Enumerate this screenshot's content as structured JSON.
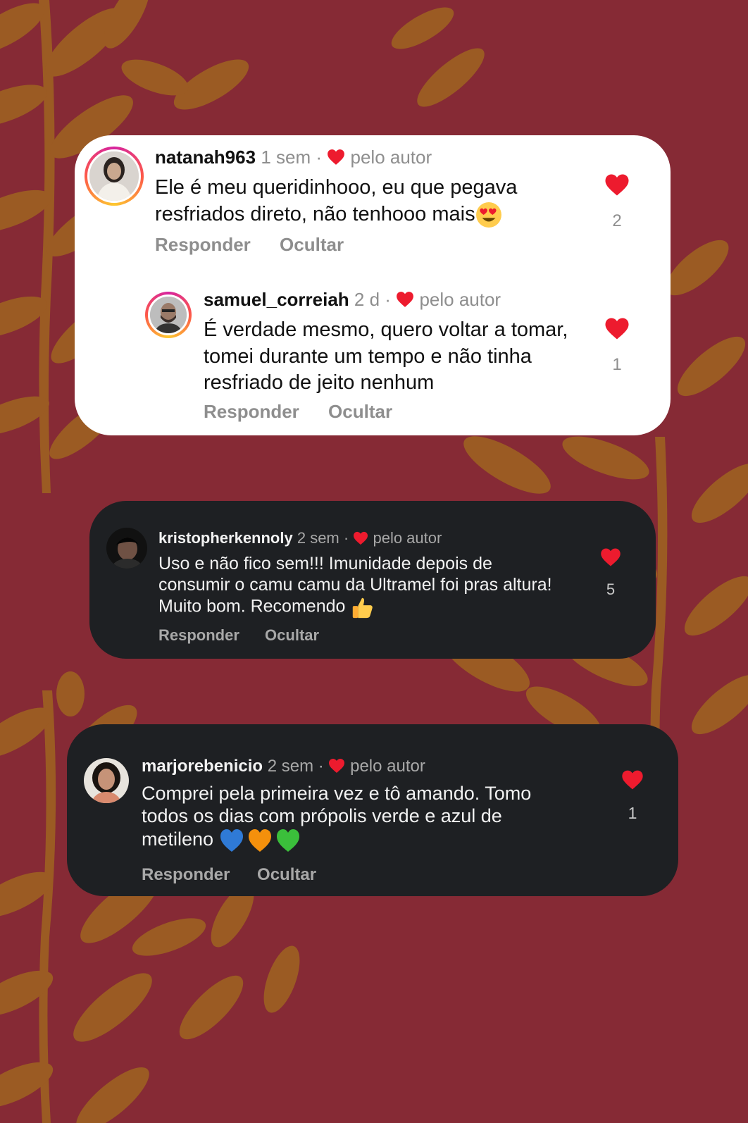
{
  "colors": {
    "background": "#862a35",
    "leaf": "#9b5b23",
    "heart": "#ed1b2e",
    "light_card": "#ffffff",
    "dark_card": "#1e2023"
  },
  "comments": [
    {
      "username": "natanah963",
      "time": "1 sem",
      "separator": "·",
      "author_like": "pelo autor",
      "text": "Ele é meu queridinhooo, eu que pegava resfriados direto, não tenhooo mais",
      "emoji": "heart-eyes-emoji",
      "reply_label": "Responder",
      "hide_label": "Ocultar",
      "likes": "2"
    },
    {
      "username": "samuel_correiah",
      "time": "2 d",
      "separator": "·",
      "author_like": "pelo autor",
      "text": "É verdade mesmo, quero voltar a tomar,  tomei durante um tempo e não tinha resfriado de jeito nenhum",
      "reply_label": "Responder",
      "hide_label": "Ocultar",
      "likes": "1"
    },
    {
      "username": "kristopherkennoly",
      "time": "2 sem",
      "separator": "·",
      "author_like": "pelo autor",
      "text": "Uso e não fico sem!!! Imunidade depois de consumir o camu camu da Ultramel foi pras altura! Muito bom. Recomendo",
      "emoji": "thumbs-up-emoji",
      "reply_label": "Responder",
      "hide_label": "Ocultar",
      "likes": "5"
    },
    {
      "username": "marjorebenicio",
      "time": "2 sem",
      "separator": "·",
      "author_like": "pelo autor",
      "text": "Comprei pela primeira vez e tô amando. Tomo todos os dias com própolis verde e azul de metileno",
      "emoji": "blue-orange-green-hearts-emoji",
      "reply_label": "Responder",
      "hide_label": "Ocultar",
      "likes": "1"
    }
  ]
}
